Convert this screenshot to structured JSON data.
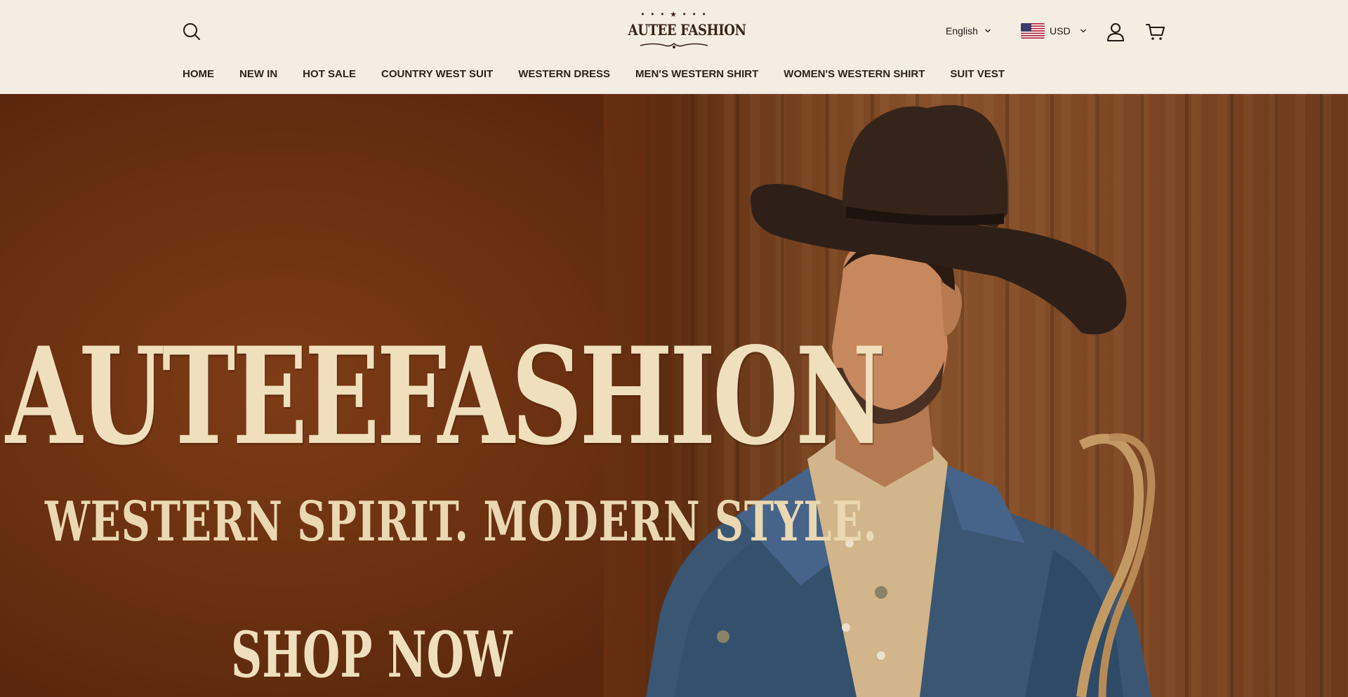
{
  "header": {
    "logo_text": "AUTEE FASHION",
    "language": "English",
    "currency": "USD"
  },
  "nav": {
    "items": [
      {
        "label": "HOME"
      },
      {
        "label": "NEW IN"
      },
      {
        "label": "HOT SALE"
      },
      {
        "label": "COUNTRY WEST SUIT"
      },
      {
        "label": "WESTERN DRESS"
      },
      {
        "label": "MEN'S WESTERN SHIRT"
      },
      {
        "label": "WOMEN'S WESTERN SHIRT"
      },
      {
        "label": "SUIT VEST"
      }
    ]
  },
  "hero": {
    "brand": "AUTEEFASHION",
    "tagline": "WESTERN SPIRIT. MODERN STYLE.",
    "cta": "SHOP NOW"
  },
  "icons": {
    "search": "search-icon",
    "account": "user-icon",
    "cart": "cart-icon",
    "flag": "us-flag-icon",
    "chevron": "chevron-down-icon"
  },
  "colors": {
    "header_bg": "#f3ede2",
    "hero_bg": "#6a3011",
    "hero_text": "#efdfbd",
    "logo": "#3b2416"
  }
}
